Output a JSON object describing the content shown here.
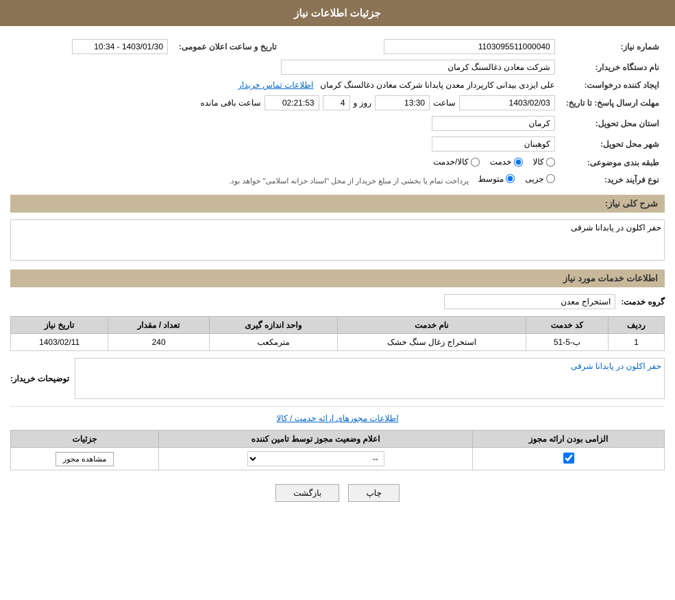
{
  "page": {
    "title": "جزئیات اطلاعات نیاز",
    "sections": {
      "main_info": "جزئیات اطلاعات نیاز",
      "services_info": "اطلاعات خدمات مورد نیاز",
      "permissions_info": "اطلاعات مجوزهای ارائه خدمت / کالا"
    }
  },
  "fields": {
    "need_number_label": "شماره نیاز:",
    "need_number_value": "1103095511000040",
    "buyer_org_label": "نام دستگاه خریدار:",
    "buyer_org_value": "شرکت معادن ذغالسنگ کرمان",
    "requester_label": "ایجاد کننده درخواست:",
    "requester_value": "علی ایزدی بیدانی کارپرداز معدن پابدانا شرکت معادن ذغالسنگ کرمان",
    "requester_link": "اطلاعات تماس خریدار",
    "send_deadline_label": "مهلت ارسال پاسخ: تا تاریخ:",
    "send_date": "1403/02/03",
    "send_time_label": "ساعت",
    "send_time": "13:30",
    "send_days_label": "روز و",
    "send_days": "4",
    "send_remaining_label": "ساعت باقی مانده",
    "send_remaining": "02:21:53",
    "announce_label": "تاریخ و ساعت اعلان عمومی:",
    "announce_value": "1403/01/30 - 10:34",
    "province_label": "استان محل تحویل:",
    "province_value": "کرمان",
    "city_label": "شهر محل تحویل:",
    "city_value": "کوهبنان",
    "category_label": "طبقه بندی موضوعی:",
    "category_options": [
      "کالا",
      "خدمت",
      "کالا/خدمت"
    ],
    "category_selected": "خدمت",
    "process_label": "نوع فرآیند خرید:",
    "process_options": [
      "جزیی",
      "متوسط"
    ],
    "process_notice": "پرداخت تمام یا بخشی از مبلغ خریدار از محل \"اسناد خزانه اسلامی\" خواهد بود.",
    "need_desc_label": "شرح کلی نیاز:",
    "need_desc_value": "حفر اکلون در پابدانا شرقی",
    "service_group_label": "گروه خدمت:",
    "service_group_value": "استخراج معدن"
  },
  "table": {
    "headers": [
      "ردیف",
      "کد خدمت",
      "نام خدمت",
      "واحد اندازه گیری",
      "تعداد / مقدار",
      "تاریخ نیاز"
    ],
    "rows": [
      {
        "row": "1",
        "code": "ب-5-51",
        "name": "استخراج زغال سنگ خشک",
        "unit": "مترمکعب",
        "qty": "240",
        "date": "1403/02/11"
      }
    ]
  },
  "buyer_notes_label": "توضیحات خریدار:",
  "buyer_notes_value": "حفر اکلون در پابدانا شرقی",
  "permissions": {
    "table_headers": [
      "الزامی بودن ارائه مجوز",
      "اعلام وضعیت مجوز توسط تامین کننده",
      "جزئیات"
    ],
    "rows": [
      {
        "required": true,
        "status": "--",
        "details_label": "مشاهده مجوز"
      }
    ]
  },
  "buttons": {
    "print": "چاپ",
    "back": "بازگشت"
  }
}
